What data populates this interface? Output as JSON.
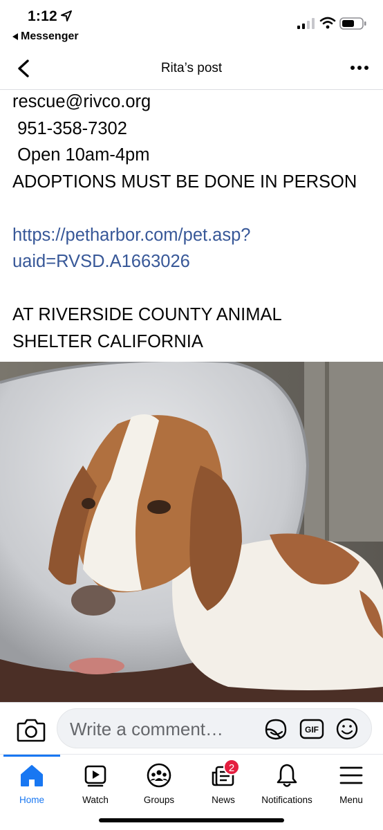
{
  "status_bar": {
    "time": "1:12",
    "back_app": "Messenger"
  },
  "header": {
    "title": "Rita’s post"
  },
  "post": {
    "lines": [
      "rescue@rivco.org",
      " 951-358-7302",
      " Open 10am-4pm",
      "ADOPTIONS MUST BE DONE IN PERSON"
    ],
    "link_lines": [
      "https://petharbor.com/pet.asp?",
      "uaid=RVSD.A1663026"
    ],
    "location_lines": [
      "AT RIVERSIDE COUNTY ANIMAL",
      "SHELTER CALIFORNIA"
    ]
  },
  "comment_bar": {
    "placeholder": "Write a comment…",
    "gif_label": "GIF"
  },
  "tabs": [
    {
      "label": "Home",
      "icon": "home-icon",
      "active": true
    },
    {
      "label": "Watch",
      "icon": "watch-icon"
    },
    {
      "label": "Groups",
      "icon": "groups-icon"
    },
    {
      "label": "News",
      "icon": "news-icon",
      "badge": "2"
    },
    {
      "label": "Notifications",
      "icon": "bell-icon"
    },
    {
      "label": "Menu",
      "icon": "menu-icon"
    }
  ],
  "colors": {
    "link": "#385898",
    "accent": "#1877f2",
    "badge": "#e41e3f"
  }
}
